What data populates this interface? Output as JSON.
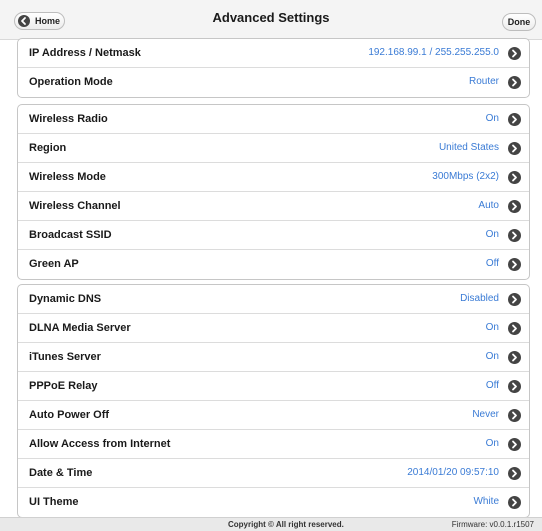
{
  "header": {
    "title": "Advanced Settings",
    "home_label": "Home",
    "done_label": "Done"
  },
  "groups": [
    {
      "rows": [
        {
          "label": "IP Address / Netmask",
          "value": "192.168.99.1 / 255.255.255.0"
        },
        {
          "label": "Operation Mode",
          "value": "Router"
        }
      ]
    },
    {
      "rows": [
        {
          "label": "Wireless Radio",
          "value": "On"
        },
        {
          "label": "Region",
          "value": "United States"
        },
        {
          "label": "Wireless Mode",
          "value": "300Mbps (2x2)"
        },
        {
          "label": "Wireless Channel",
          "value": "Auto"
        },
        {
          "label": "Broadcast SSID",
          "value": "On"
        },
        {
          "label": "Green AP",
          "value": "Off"
        }
      ]
    },
    {
      "rows": [
        {
          "label": "Dynamic DNS",
          "value": "Disabled"
        },
        {
          "label": "DLNA Media Server",
          "value": "On"
        },
        {
          "label": "iTunes Server",
          "value": "On"
        },
        {
          "label": "PPPoE Relay",
          "value": "Off"
        },
        {
          "label": "Auto Power Off",
          "value": "Never"
        },
        {
          "label": "Allow Access from Internet",
          "value": "On"
        },
        {
          "label": "Date & Time",
          "value": "2014/01/20 09:57:10"
        },
        {
          "label": "UI Theme",
          "value": "White"
        }
      ]
    }
  ],
  "footer": {
    "copyright": "Copyright © All right reserved.",
    "firmware": "Firmware: v0.0.1.r1507"
  },
  "icons": {
    "home": "back-arrow-icon",
    "row": "chevron-right-icon"
  },
  "colors": {
    "value_text": "#3a7bd5",
    "icon_fill": "#444444"
  }
}
